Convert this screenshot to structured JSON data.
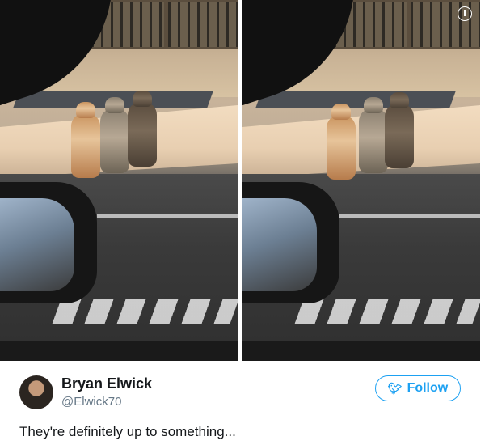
{
  "tweet": {
    "author_name": "Bryan Elwick",
    "author_handle": "@Elwick70",
    "follow_label": "Follow",
    "text": "They're definitely up to something...",
    "avatar_icon": "user-avatar-photo"
  },
  "photo": {
    "info_icon_glyph": "i",
    "panels": 2,
    "subjects": [
      "cat",
      "cat",
      "cat"
    ]
  },
  "colors": {
    "follow_accent": "#1da1f2",
    "name_text": "#14171a",
    "handle_text": "#657786"
  }
}
